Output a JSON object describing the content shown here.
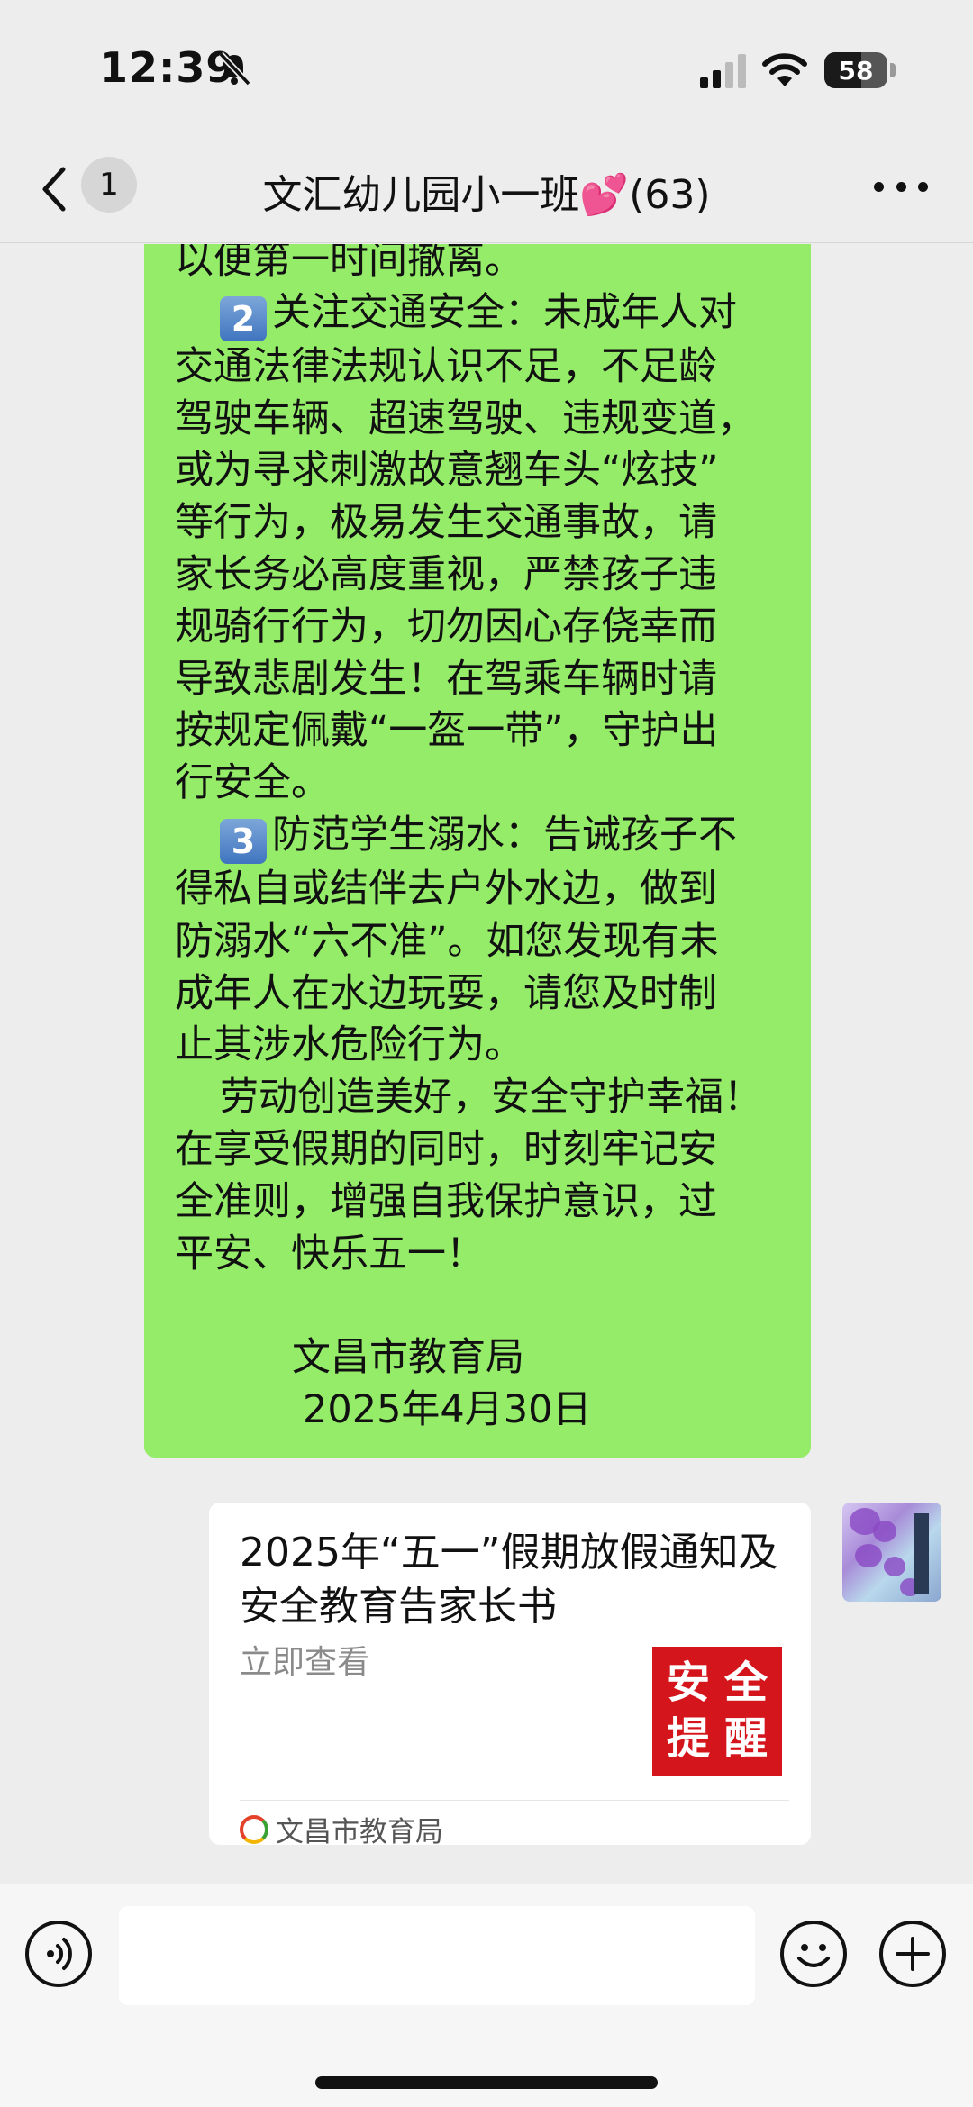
{
  "status_bar": {
    "time": "12:39",
    "battery_level": "58",
    "icons": [
      "bell-off-icon",
      "signal-icon",
      "wifi-icon",
      "battery-icon"
    ]
  },
  "nav": {
    "unread_count": "1",
    "title": "文汇幼儿园小一班💕(63)"
  },
  "message": {
    "lines": [
      "以便第一时间撤离。",
      "关注交通安全：未成年人对",
      "交通法律法规认识不足，不足龄",
      "驾驶车辆、超速驾驶、违规变道，",
      "或为寻求刺激故意翘车头“炫技”",
      "等行为，极易发生交通事故，请",
      "家长务必高度重视，严禁孩子违",
      "规骑行行为，切勿因心存侥幸而",
      "导致悲剧发生！在驾乘车辆时请",
      "按规定佩戴“一盔一带”，守护出",
      "行安全。",
      "防范学生溺水：告诫孩子不",
      "得私自或结伴去户外水边，做到",
      "防溺水“六不准”。如您发现有未",
      "成年人在水边玩耍，请您及时制",
      "止其涉水危险行为。",
      "劳动创造美好，安全守护幸福！",
      "在享受假期的同时，时刻牢记安",
      "全准则，增强自我保护意识，过",
      "平安、快乐五一！",
      "文昌市教育局",
      "2025年4月30日"
    ],
    "keycap_2": "2",
    "keycap_3": "3"
  },
  "link_card": {
    "title": "2025年“五一”假期放假通知及安全教育告家长书",
    "action": "立即查看",
    "thumb_chars": [
      "安",
      "全",
      "提",
      "醒"
    ],
    "source": "文昌市教育局"
  },
  "colors": {
    "bubble_green": "#95ec69",
    "thumb_red": "#d4161c",
    "background": "#ededed"
  }
}
